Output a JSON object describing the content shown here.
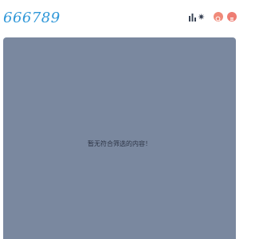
{
  "header": {
    "logo_text": "666789",
    "icons": {
      "stats": "bar-chart-icon",
      "theme": "sun-icon",
      "search": "search-icon",
      "menu": "menu-icon"
    },
    "colors": {
      "logo": "#2f97d8",
      "accent": "#ee7d73"
    }
  },
  "main": {
    "empty_message": "暂无符合筛选的内容！",
    "panel_color": "#7a889f"
  }
}
